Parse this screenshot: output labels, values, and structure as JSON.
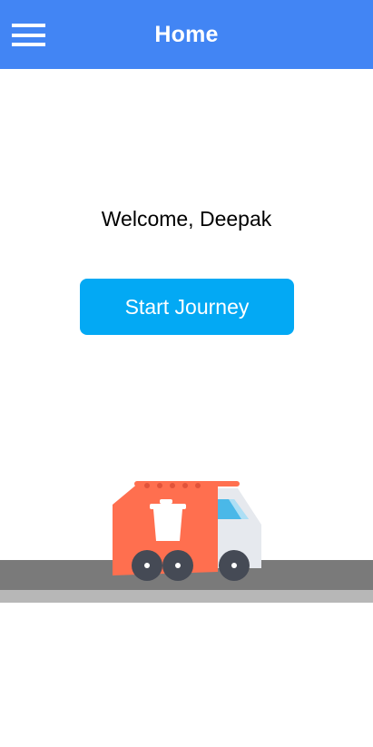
{
  "appbar": {
    "title": "Home",
    "menu_icon": "hamburger-menu-icon",
    "background": "#4285f4"
  },
  "main": {
    "welcome_text": "Welcome, Deepak",
    "start_button_label": "Start Journey",
    "button_color": "#03a9f4"
  },
  "illustration": {
    "truck_icon": "garbage-truck-icon",
    "truck_color": "#ff6f4f",
    "road_color": "#7a7a7a"
  }
}
